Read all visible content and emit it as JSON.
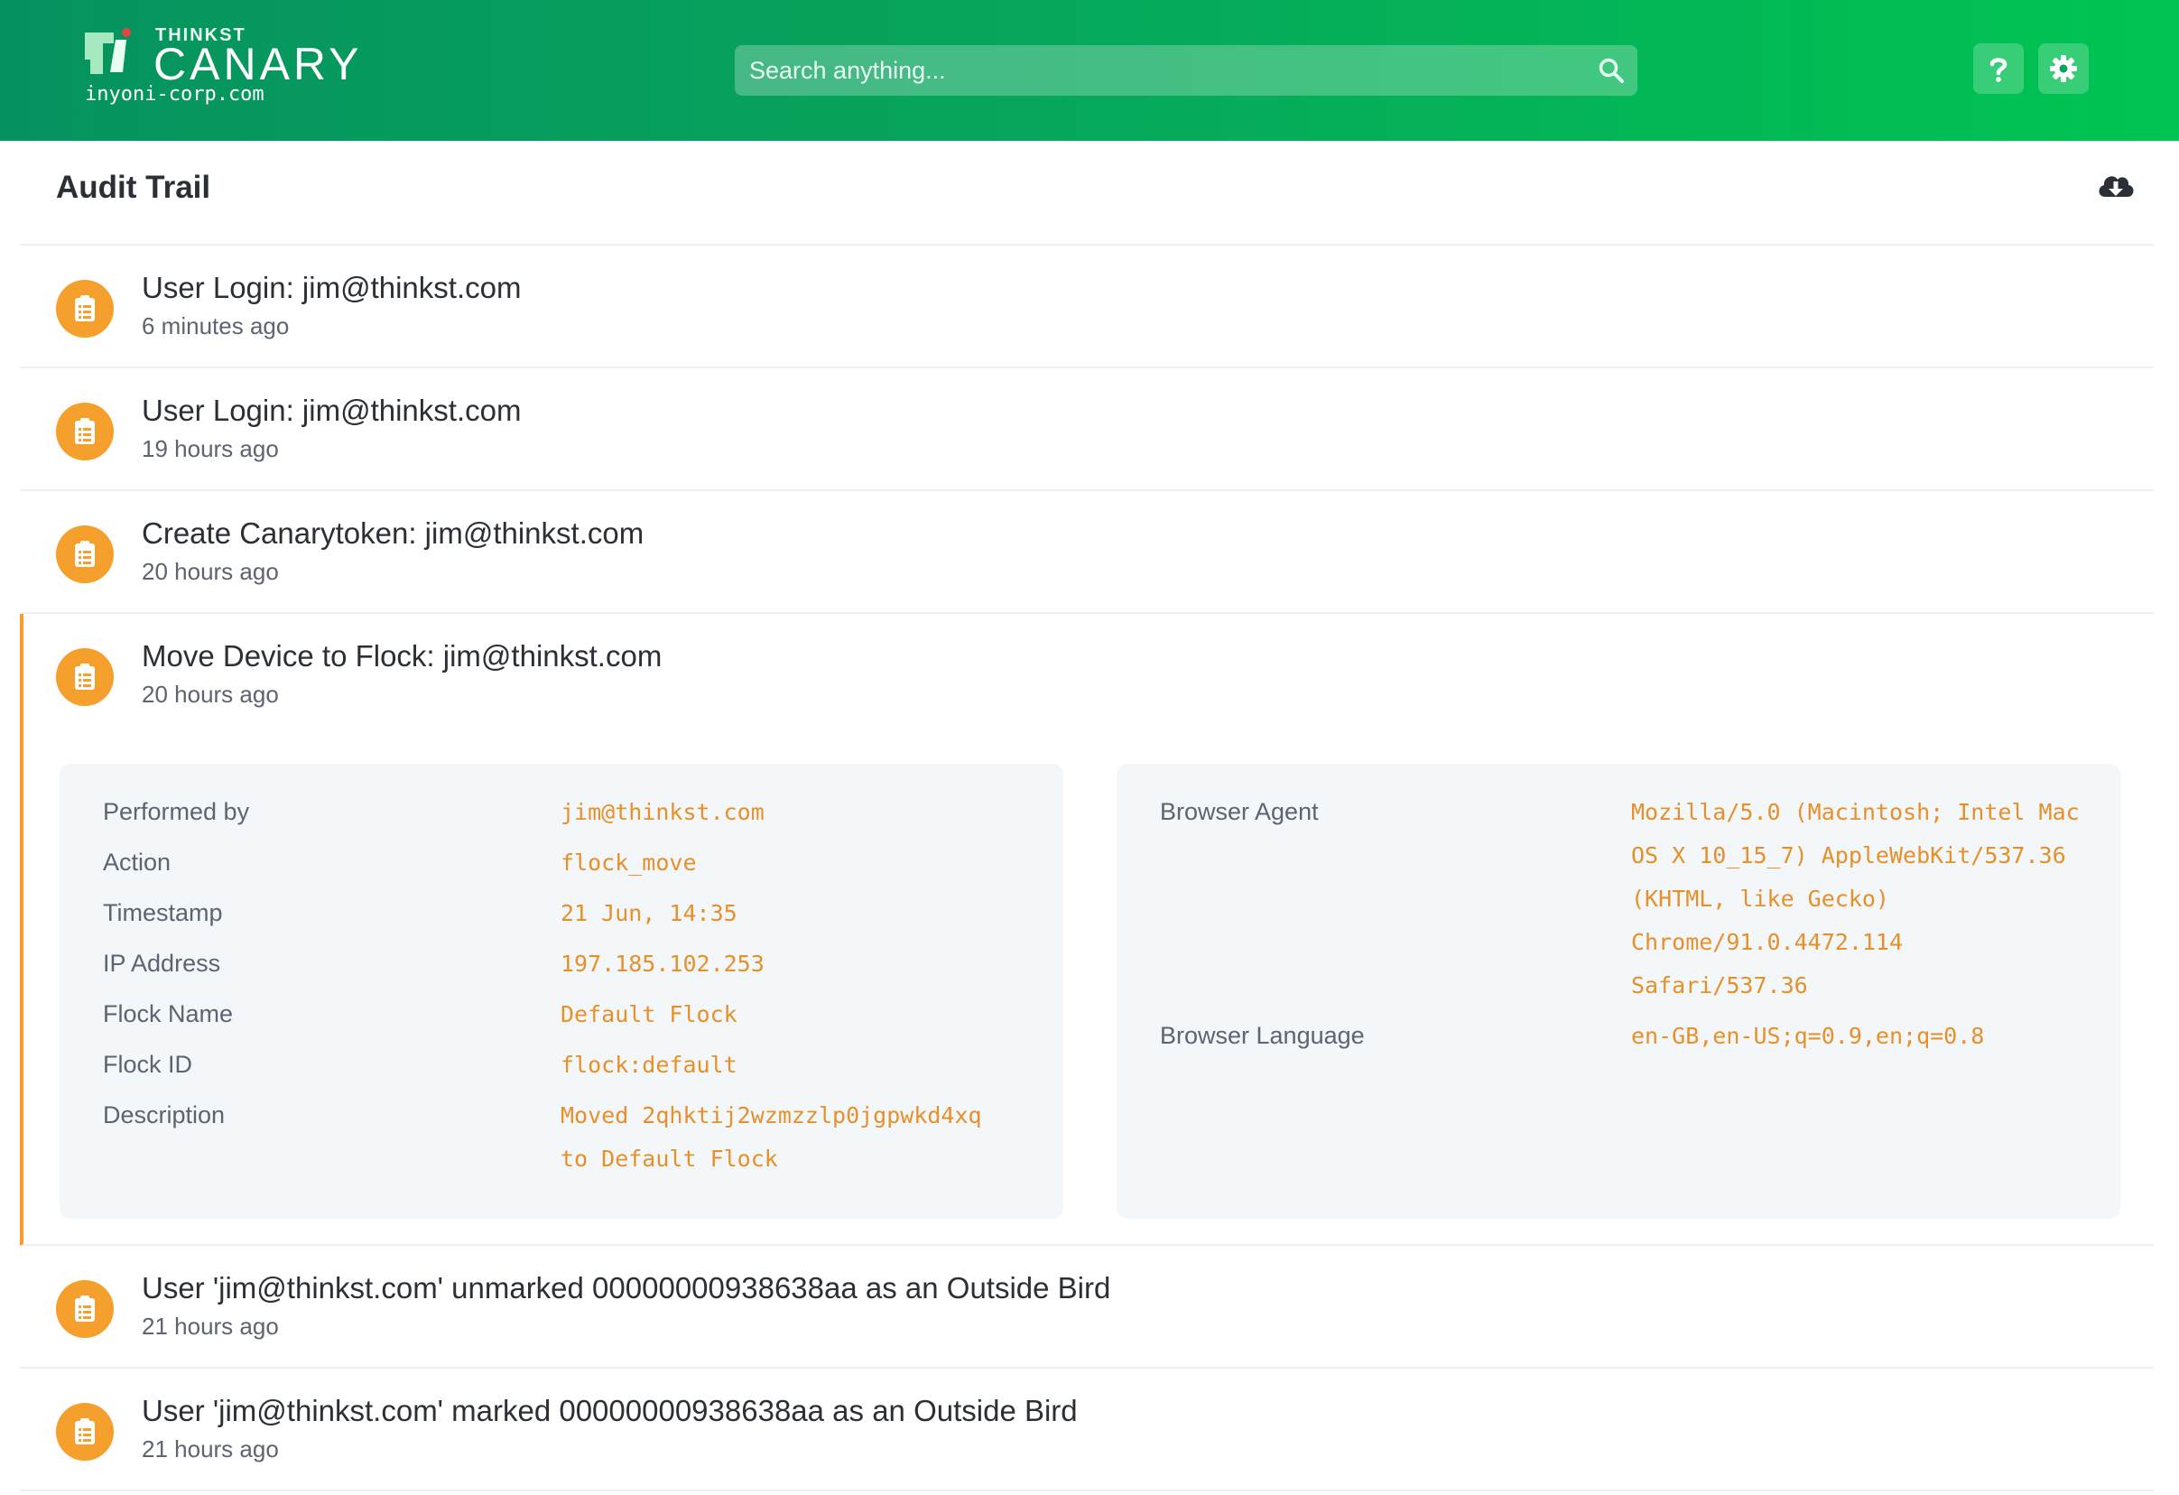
{
  "header": {
    "brand_small": "THINKST",
    "brand_big": "CANARY",
    "org": "inyoni-corp.com",
    "search_placeholder": "Search anything...",
    "colors": {
      "gradient_start": "#06925f",
      "gradient_end": "#00c452"
    }
  },
  "page": {
    "title": "Audit Trail"
  },
  "items": [
    {
      "title": "User Login: jim@thinkst.com",
      "time": "6 minutes ago"
    },
    {
      "title": "User Login: jim@thinkst.com",
      "time": "19 hours ago"
    },
    {
      "title": "Create Canarytoken: jim@thinkst.com",
      "time": "20 hours ago"
    },
    {
      "title": "Move Device to Flock: jim@thinkst.com",
      "time": "20 hours ago",
      "expanded": true,
      "details_left": [
        {
          "label": "Performed by",
          "value": "jim@thinkst.com"
        },
        {
          "label": "Action",
          "value": "flock_move"
        },
        {
          "label": "Timestamp",
          "value": "21 Jun, 14:35"
        },
        {
          "label": "IP Address",
          "value": "197.185.102.253"
        },
        {
          "label": "Flock Name",
          "value": "Default Flock"
        },
        {
          "label": "Flock ID",
          "value": "flock:default"
        },
        {
          "label": "Description",
          "value_lines": [
            "Moved 2qhktij2wzmzzlp0jgpwkd4xq",
            "to Default Flock"
          ]
        }
      ],
      "details_right": [
        {
          "label": "Browser Agent",
          "value_lines": [
            "Mozilla/5.0 (Macintosh; Intel Mac",
            "OS X 10_15_7) AppleWebKit/537.36",
            "(KHTML, like Gecko)",
            "Chrome/91.0.4472.114",
            "Safari/537.36"
          ]
        },
        {
          "label": "Browser Language",
          "value": "en-GB,en-US;q=0.9,en;q=0.8"
        }
      ]
    },
    {
      "title": "User 'jim@thinkst.com' unmarked 00000000938638aa as an Outside Bird",
      "time": "21 hours ago"
    },
    {
      "title": "User 'jim@thinkst.com' marked 00000000938638aa as an Outside Bird",
      "time": "21 hours ago"
    }
  ],
  "icons": {
    "logo": "canary-logo-icon",
    "search": "search-icon",
    "help": "question-icon",
    "settings": "gear-icon",
    "download": "cloud-download-icon",
    "item": "clipboard-icon"
  },
  "colors": {
    "accent": "#f5a02c",
    "value_text": "#e7902a",
    "detail_bg": "#f4f7fa"
  }
}
